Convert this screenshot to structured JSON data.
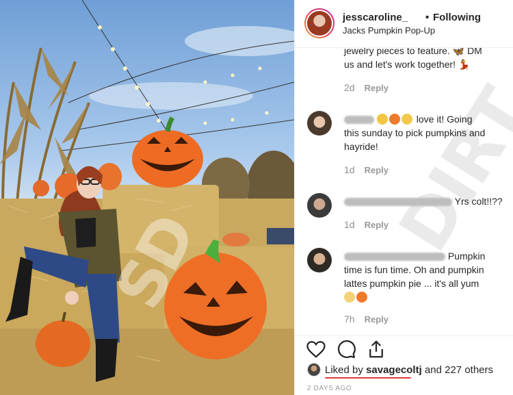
{
  "post": {
    "username": "jesscaroline_",
    "separator": "•",
    "follow_status": "Following",
    "location": "Jacks Pumpkin Pop-Up",
    "photo_watermark": "SD"
  },
  "comments": [
    {
      "text_line1": "jewelry pieces to feature. 🦋 DM",
      "text_line2": "us and let's work together! 💃",
      "time": "2d",
      "reply": "Reply"
    },
    {
      "text_line1": "love it! Going",
      "text_line2": "this sunday to pick pumpkins and",
      "text_line3": "hayride!",
      "time": "1d",
      "reply": "Reply"
    },
    {
      "text_line1": "Yrs colt!!??",
      "time": "1d",
      "reply": "Reply"
    },
    {
      "text_line1": "Pumpkin",
      "text_line2": "time is fun time. Oh and pumpkin",
      "text_line3": "lattes pumpkin pie ... it's all yum",
      "time": "7h",
      "reply": "Reply"
    }
  ],
  "panel_watermark": "DIRT",
  "actions": {
    "like_icon": "heart-icon",
    "comment_icon": "comment-icon",
    "share_icon": "share-icon"
  },
  "likes": {
    "prefix": "Liked by ",
    "liker": "savagecoltj",
    "suffix": " and 227 others"
  },
  "timestamp": "2 DAYS AGO",
  "colors": {
    "accent_underline": "#e23b3b",
    "pumpkin": "#ee6b24",
    "muted": "#8e8e8e"
  }
}
